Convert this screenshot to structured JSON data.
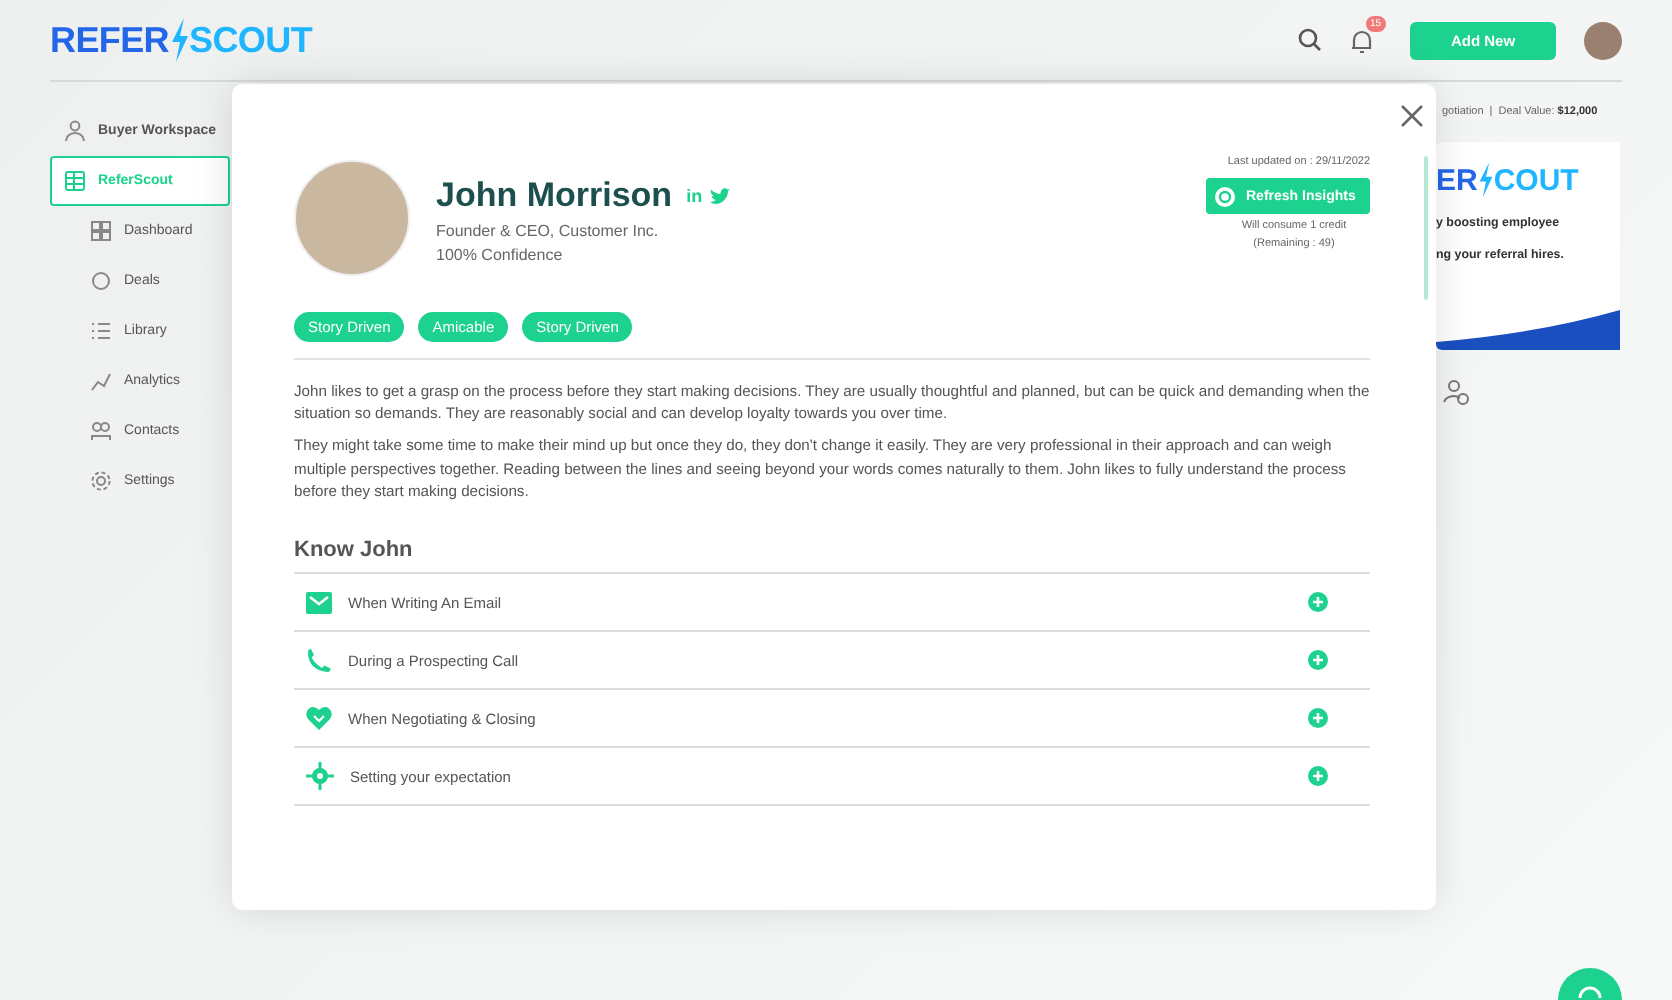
{
  "header": {
    "logo_left": "REFER",
    "logo_right": "SCOUT",
    "notification_count": "15",
    "add_button": "Add New"
  },
  "sidebar": {
    "items": [
      {
        "label": "Buyer Workspace",
        "selected": false
      },
      {
        "label": "ReferScout",
        "selected": true,
        "children": [
          {
            "label": "Dashboard"
          },
          {
            "label": "Deals"
          },
          {
            "label": "Library"
          },
          {
            "label": "Analytics"
          },
          {
            "label": "Contacts"
          },
          {
            "label": "Settings"
          }
        ]
      }
    ]
  },
  "deal_info": {
    "stage": "gotiation",
    "separator": "|",
    "value_label": "Deal Value:",
    "value": "$12,000"
  },
  "banner": {
    "logo_left": "ER",
    "logo_right": "COUT",
    "line_1": "y boosting employee",
    "line_2": "ng your referral hires."
  },
  "modal": {
    "name": "John Morrison",
    "socials": [
      {
        "kind": "linkedin",
        "label": "in"
      },
      {
        "kind": "twitter"
      }
    ],
    "title": "Founder & CEO, Customer Inc.",
    "confidence": "100% Confidence",
    "last_updated": "Last updated on : 29/11/2022",
    "refresh_button": "Refresh Insights",
    "credit_note": "Will consume 1 credit",
    "remaining": "(Remaining : 49)",
    "tags": [
      "Story Driven",
      "Amicable",
      "Story Driven"
    ],
    "paragraphs": [
      "John likes to get a grasp on the process before they start making decisions. They are usually thoughtful and planned, but can be quick and demanding when the situation so demands. They are reasonably social and can develop loyalty towards you over time.",
      "They might take some time to make their mind up but once they do, they don't change it easily. They are very professional in their approach and can weigh multiple perspectives together. Reading between the lines and seeing beyond your words comes naturally to them. John likes to fully understand the process before they start making decisions."
    ],
    "section_title": "Know John",
    "sections": [
      {
        "kind": "email",
        "label": "When Writing An Email"
      },
      {
        "kind": "phone",
        "label": "During a Prospecting Call"
      },
      {
        "kind": "handshake",
        "label": "When Negotiating & Closing"
      },
      {
        "kind": "target",
        "label": "Setting your expectation"
      }
    ]
  }
}
